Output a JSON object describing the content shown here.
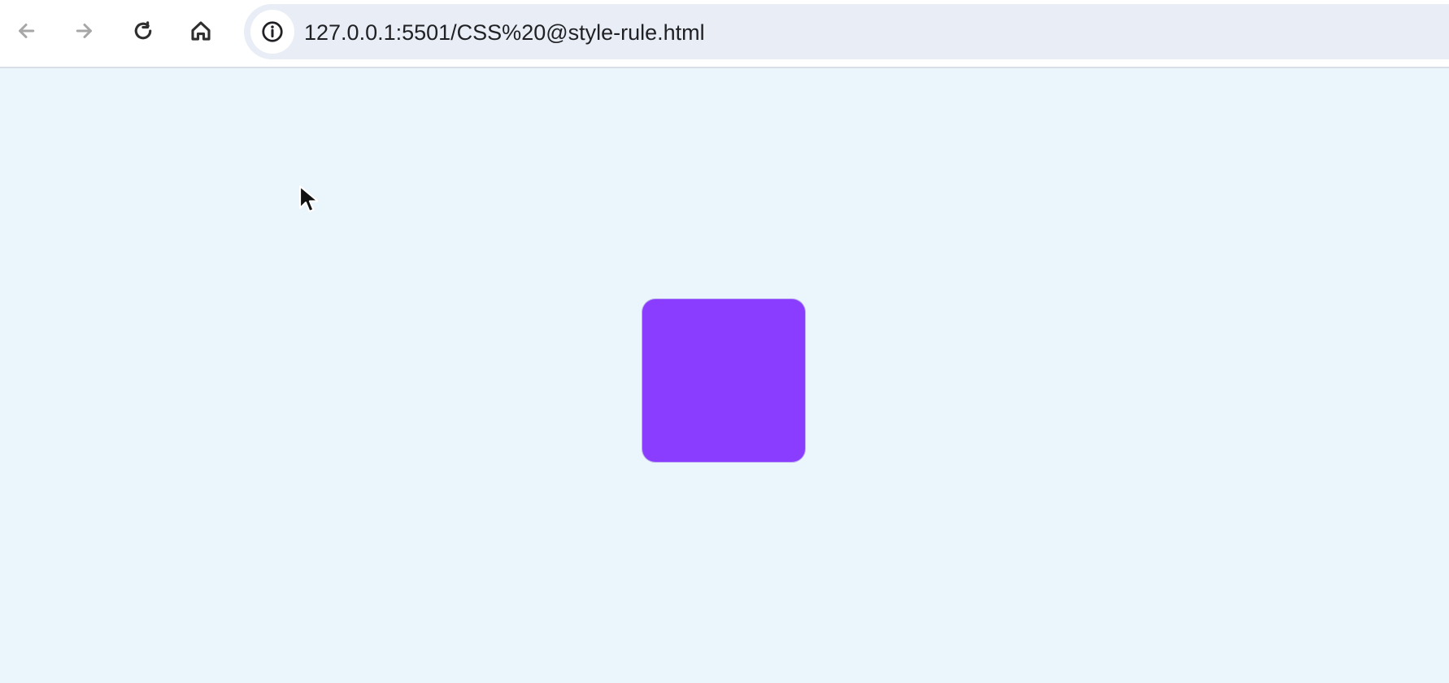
{
  "browser": {
    "url": "127.0.0.1:5501/CSS%20@style-rule.html",
    "buttons": {
      "back_icon": "arrow-left-icon",
      "forward_icon": "arrow-right-icon",
      "reload_icon": "reload-icon",
      "home_icon": "home-icon",
      "info_icon": "info-icon"
    }
  },
  "page": {
    "background_color": "#eaf5fc",
    "box_color": "#8b3dff"
  },
  "cursor": {
    "icon": "mouse-pointer-icon"
  }
}
